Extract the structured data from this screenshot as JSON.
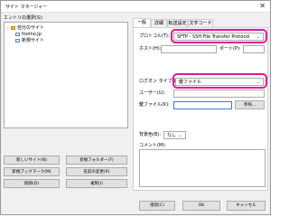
{
  "window": {
    "title": "サイト マネージャー",
    "close_glyph": "✕"
  },
  "left": {
    "label": "エントリの選択(S):",
    "tree": [
      {
        "label": "自分のサイト",
        "icon": "folder-icon"
      },
      {
        "label": "foomo.jp",
        "icon": "site-icon"
      },
      {
        "label": "新規サイト",
        "icon": "site-icon"
      }
    ],
    "buttons": {
      "new_site": "新しいサイト(N)",
      "new_folder": "新規フォルダー(F)",
      "new_bookmark": "新規ブックマーク(M)",
      "rename": "名前の変更(R)",
      "delete": "削除(D)",
      "duplicate": "複製(I)"
    }
  },
  "tabs": [
    "一般",
    "詳細",
    "転送設定",
    "文字コード"
  ],
  "general": {
    "protocol_label": "プロトコル(T):",
    "protocol_value": "SFTP - SSH File Transfer Protocol",
    "host_label": "ホスト(H):",
    "host_value": "",
    "port_label": "ポート(P):",
    "port_value": "",
    "logon_label": "ログオン タイプ(L):",
    "logon_value": "鍵ファイル",
    "user_label": "ユーザー(U):",
    "user_value": "",
    "keyfile_label": "鍵ファイル(K):",
    "keyfile_value": "",
    "browse_button": "参照...",
    "bgcolor_label": "背景色(B):",
    "bgcolor_value": "なし",
    "comment_label": "コメント(M):",
    "comment_value": ""
  },
  "footer": {
    "connect": "接続(C)",
    "ok": "OK",
    "cancel": "キャンセル"
  },
  "colors": {
    "highlight": "#e0179b",
    "window_bg": "#f0f0f0"
  }
}
